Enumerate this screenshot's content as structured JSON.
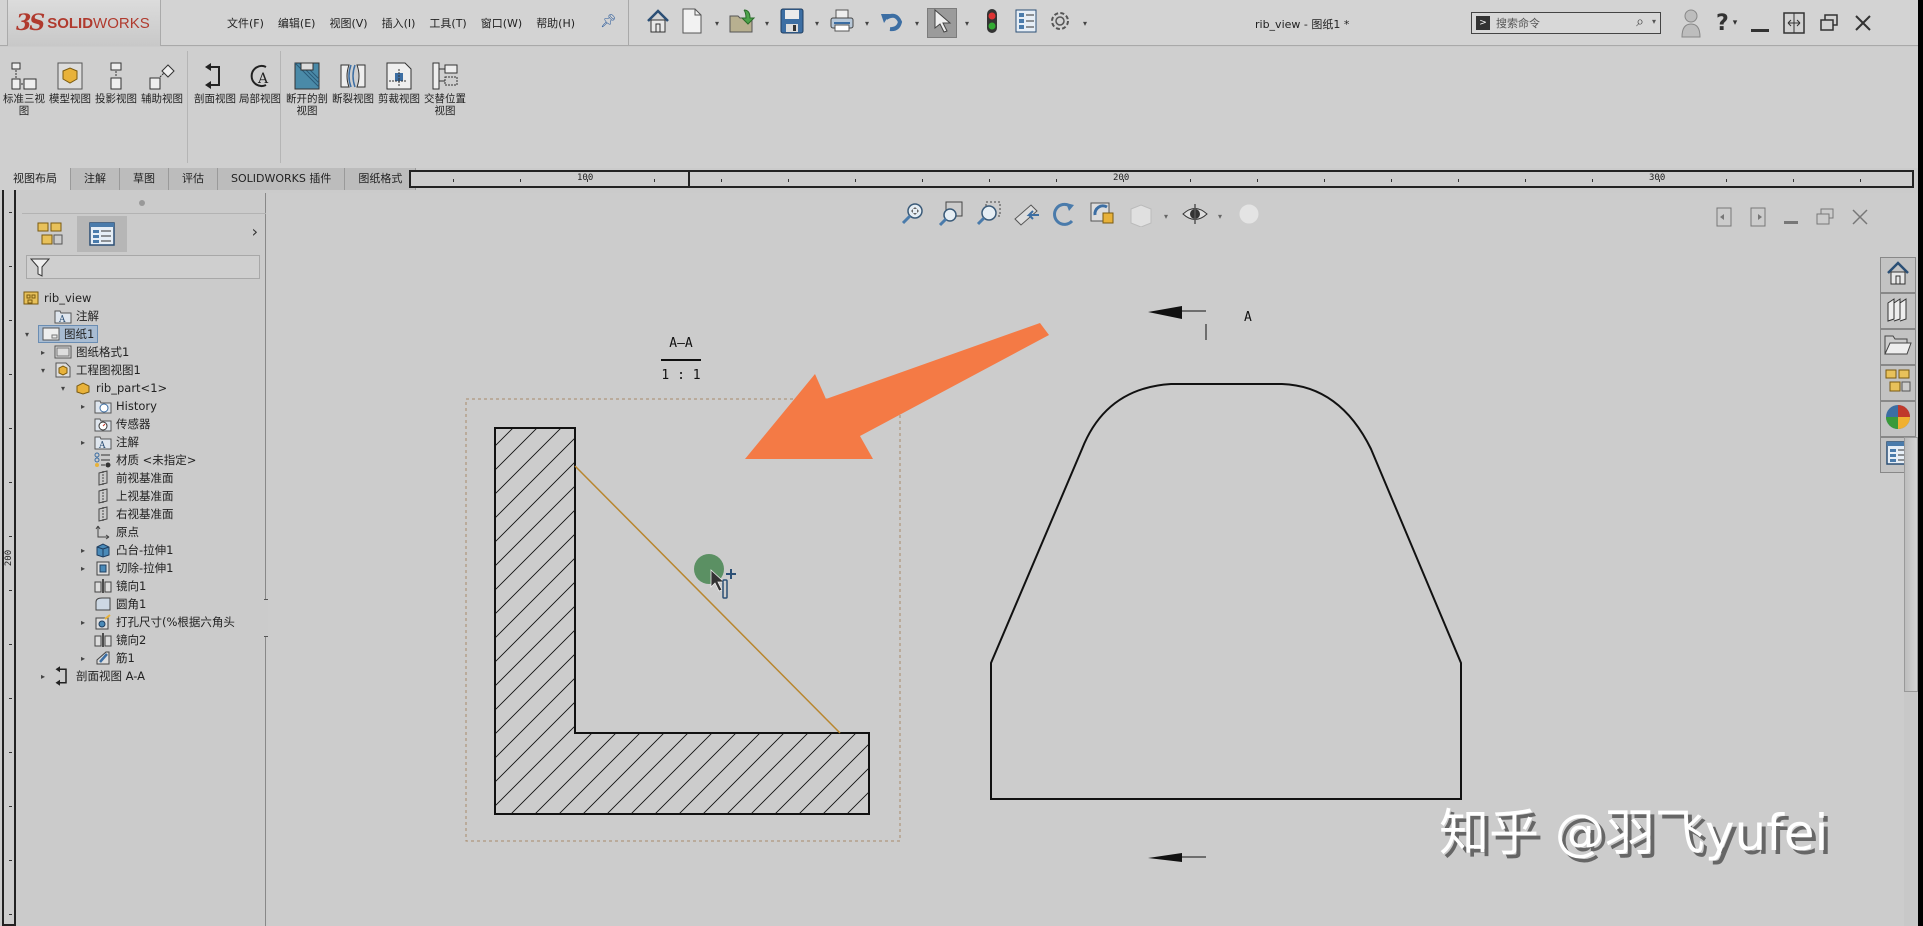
{
  "app": {
    "brand_ds": "3S",
    "brand_name_bold": "SOLID",
    "brand_name_light": "WORKS",
    "document_title": "rib_view - 图纸1 *"
  },
  "menu": [
    "文件(F)",
    "编辑(E)",
    "视图(V)",
    "插入(I)",
    "工具(T)",
    "窗口(W)",
    "帮助(H)"
  ],
  "quick_access": [
    {
      "name": "home-icon"
    },
    {
      "name": "new-document-icon",
      "dropdown": true
    },
    {
      "name": "open-folder-icon",
      "dropdown": true
    },
    {
      "name": "save-icon",
      "dropdown": true
    },
    {
      "name": "print-icon",
      "dropdown": true
    },
    {
      "name": "undo-icon",
      "dropdown": true
    },
    {
      "name": "select-pointer-icon",
      "dropdown": true,
      "selected": true
    },
    {
      "name": "rebuild-traffic-light-icon"
    },
    {
      "name": "file-properties-icon"
    },
    {
      "name": "options-gear-icon",
      "dropdown": true
    }
  ],
  "search": {
    "placeholder": "搜索命令"
  },
  "command_manager": {
    "groups": [
      [
        {
          "label": "标准三视图",
          "icon": "standard-3-view-icon"
        },
        {
          "label": "模型视图",
          "icon": "model-view-icon"
        },
        {
          "label": "投影视图",
          "icon": "projected-view-icon"
        },
        {
          "label": "辅助视图",
          "icon": "auxiliary-view-icon"
        }
      ],
      [
        {
          "label": "剖面视图",
          "icon": "section-view-icon"
        },
        {
          "label": "局部视图",
          "icon": "detail-view-icon"
        }
      ],
      [
        {
          "label": "断开的剖视图",
          "icon": "broken-out-section-icon"
        },
        {
          "label": "断裂视图",
          "icon": "break-view-icon"
        },
        {
          "label": "剪裁视图",
          "icon": "crop-view-icon"
        },
        {
          "label": "交替位置视图",
          "icon": "alternate-position-view-icon"
        }
      ]
    ],
    "tabs": [
      {
        "label": "视图布局",
        "active": true
      },
      {
        "label": "注解"
      },
      {
        "label": "草图"
      },
      {
        "label": "评估"
      },
      {
        "label": "SOLIDWORKS 插件"
      },
      {
        "label": "图纸格式"
      }
    ]
  },
  "rulers": {
    "horizontal_labels": [
      "100",
      "200",
      "300"
    ],
    "vertical_labels": [
      "200"
    ]
  },
  "feature_tree": {
    "items": [
      {
        "label": "rib_view",
        "icon": "drawing-icon",
        "level": 0,
        "expand": ""
      },
      {
        "label": "注解",
        "icon": "annotations-folder-icon",
        "level": 1,
        "expand": ""
      },
      {
        "label": "图纸1",
        "icon": "sheet-icon",
        "level": 0,
        "expand": "open",
        "selected": true
      },
      {
        "label": "图纸格式1",
        "icon": "sheet-format-icon",
        "level": 1,
        "expand": "closed"
      },
      {
        "label": "工程图视图1",
        "icon": "drawing-view-icon",
        "level": 1,
        "expand": "open"
      },
      {
        "label": "rib_part<1>",
        "icon": "part-icon",
        "level": 2,
        "expand": "open"
      },
      {
        "label": "History",
        "icon": "history-folder-icon",
        "level": 3,
        "expand": "closed"
      },
      {
        "label": "传感器",
        "icon": "sensor-folder-icon",
        "level": 3,
        "expand": ""
      },
      {
        "label": "注解",
        "icon": "annotations-folder-icon",
        "level": 3,
        "expand": "closed"
      },
      {
        "label": "材质 <未指定>",
        "icon": "material-icon",
        "level": 3,
        "expand": ""
      },
      {
        "label": "前视基准面",
        "icon": "plane-icon",
        "level": 3,
        "expand": ""
      },
      {
        "label": "上视基准面",
        "icon": "plane-icon",
        "level": 3,
        "expand": ""
      },
      {
        "label": "右视基准面",
        "icon": "plane-icon",
        "level": 3,
        "expand": ""
      },
      {
        "label": "原点",
        "icon": "origin-icon",
        "level": 3,
        "expand": ""
      },
      {
        "label": "凸台-拉伸1",
        "icon": "boss-extrude-icon",
        "level": 3,
        "expand": "closed"
      },
      {
        "label": "切除-拉伸1",
        "icon": "cut-extrude-icon",
        "level": 3,
        "expand": "closed"
      },
      {
        "label": "镜向1",
        "icon": "mirror-icon",
        "level": 3,
        "expand": ""
      },
      {
        "label": "圆角1",
        "icon": "fillet-icon",
        "level": 3,
        "expand": ""
      },
      {
        "label": "打孔尺寸(%根据六角头",
        "icon": "hole-wizard-icon",
        "level": 3,
        "expand": "closed"
      },
      {
        "label": "镜向2",
        "icon": "mirror-icon",
        "level": 3,
        "expand": ""
      },
      {
        "label": "筋1",
        "icon": "rib-icon",
        "level": 3,
        "expand": "closed"
      },
      {
        "label": "剖面视图 A-A",
        "icon": "section-view-icon",
        "level": 1,
        "expand": "closed"
      }
    ]
  },
  "heads_up_toolbar": [
    "zoom-to-fit-icon",
    "zoom-to-area-icon",
    "zoom-in-out-icon",
    "previous-view-icon",
    "rotate-icon",
    "3d-drawing-view-icon",
    "display-style-icon",
    "hide-show-icon",
    "appearance-icon"
  ],
  "task_pane": [
    "home-icon",
    "design-library-icon",
    "file-explorer-icon",
    "view-palette-icon",
    "appearances-icon",
    "custom-properties-icon"
  ],
  "drawing": {
    "section_label": "A—A",
    "scale_label": "1 : 1",
    "cut_line_label": "A",
    "watermark": "知乎 @羽飞yufei",
    "annotation_arrow_color": "#f47a45",
    "rib_edge_color": "#b8862e",
    "hover_dot_color": "#4f8a58"
  }
}
